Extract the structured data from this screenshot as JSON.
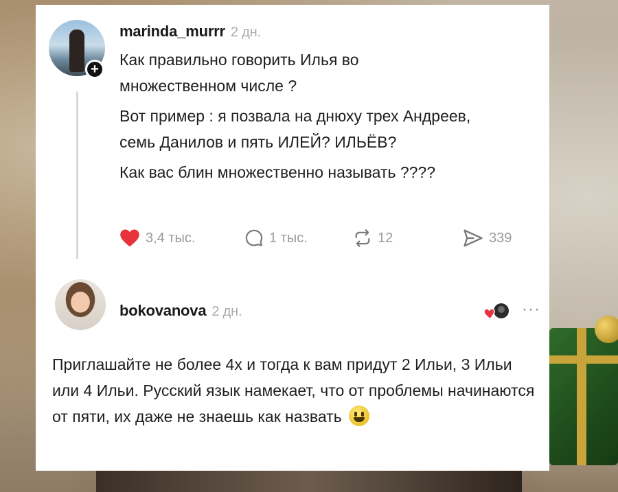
{
  "post": {
    "username": "marinda_murrr",
    "time": "2 дн.",
    "paragraphs": [
      "Как правильно говорить Илья во множественном числе ?",
      "Вот пример : я позвала на днюху трех Андреев, семь Данилов и пять ИЛЕЙ? ИЛЬЁВ?",
      "Как вас блин множественно называть ????"
    ],
    "actions": {
      "likes": "3,4 тыс.",
      "comments": "1 тыс.",
      "reposts": "12",
      "shares": "339"
    }
  },
  "reply": {
    "username": "bokovanova",
    "time": "2 дн.",
    "text": "Приглашайте не более 4х и тогда к вам придут 2 Ильи, 3 Ильи или 4 Ильи. Русский язык намекает, что от проблемы начинаются от пяти, их даже не знаешь как назвать",
    "more": "···"
  },
  "colors": {
    "like": "#e8323c",
    "muted": "#9a9a9a",
    "text": "#1f1f1f"
  },
  "icons": [
    "plus-icon",
    "heart-icon",
    "comment-icon",
    "repost-icon",
    "share-icon",
    "more-icon",
    "smiley-emoji-icon"
  ]
}
